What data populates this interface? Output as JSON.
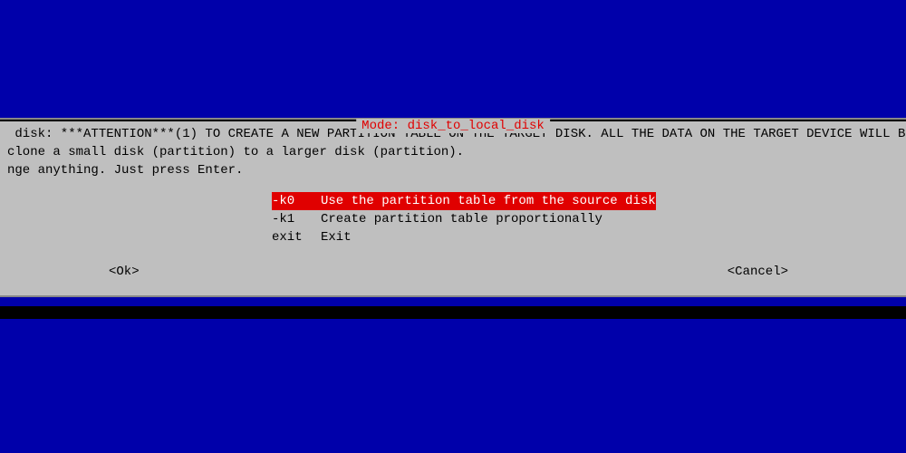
{
  "dialog": {
    "title": "Mode: disk_to_local_disk",
    "message": {
      "line1": " disk: ***ATTENTION***(1) TO CREATE A NEW PARTITION TABLE ON THE TARGET DISK. ALL THE DATA ON THE TARGET DEVICE WILL BE ",
      "line2": "clone a small disk (partition) to a larger disk (partition).",
      "line3": "nge anything. Just press Enter."
    },
    "options": [
      {
        "key": "-k0",
        "label": "Use the partition table from the source disk",
        "selected": true
      },
      {
        "key": "-k1",
        "label": "Create partition table proportionally",
        "selected": false
      },
      {
        "key": "exit",
        "label": "Exit",
        "selected": false
      }
    ],
    "buttons": {
      "ok": "<Ok>",
      "cancel": "<Cancel>"
    }
  }
}
